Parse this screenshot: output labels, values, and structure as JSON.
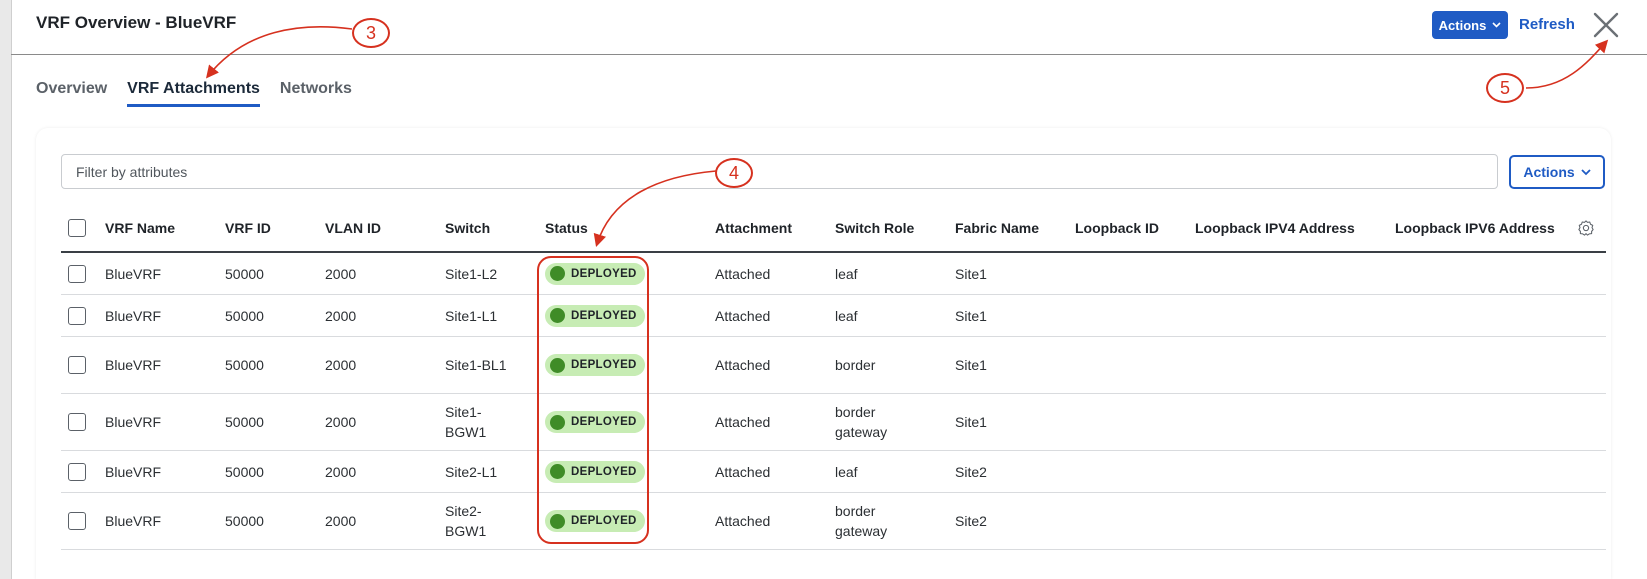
{
  "header": {
    "title": "VRF Overview - BlueVRF",
    "actions_label": "Actions",
    "refresh_label": "Refresh"
  },
  "tabs": [
    {
      "label": "Overview",
      "active": false
    },
    {
      "label": "VRF Attachments",
      "active": true
    },
    {
      "label": "Networks",
      "active": false
    }
  ],
  "toolbar": {
    "filter_placeholder": "Filter by attributes",
    "actions_label": "Actions"
  },
  "table": {
    "columns": [
      "VRF Name",
      "VRF ID",
      "VLAN ID",
      "Switch",
      "Status",
      "Attachment",
      "Switch Role",
      "Fabric Name",
      "Loopback ID",
      "Loopback IPV4 Address",
      "Loopback IPV6 Address"
    ],
    "rows": [
      {
        "vrf_name": "BlueVRF",
        "vrf_id": "50000",
        "vlan_id": "2000",
        "switch": "Site1-L2",
        "status": "DEPLOYED",
        "attachment": "Attached",
        "switch_role": "leaf",
        "fabric_name": "Site1",
        "loopback_id": "",
        "loopback_ipv4": "",
        "loopback_ipv6": ""
      },
      {
        "vrf_name": "BlueVRF",
        "vrf_id": "50000",
        "vlan_id": "2000",
        "switch": "Site1-L1",
        "status": "DEPLOYED",
        "attachment": "Attached",
        "switch_role": "leaf",
        "fabric_name": "Site1",
        "loopback_id": "",
        "loopback_ipv4": "",
        "loopback_ipv6": ""
      },
      {
        "vrf_name": "BlueVRF",
        "vrf_id": "50000",
        "vlan_id": "2000",
        "switch": "Site1-BL1",
        "status": "DEPLOYED",
        "attachment": "Attached",
        "switch_role": "border",
        "fabric_name": "Site1",
        "loopback_id": "",
        "loopback_ipv4": "",
        "loopback_ipv6": ""
      },
      {
        "vrf_name": "BlueVRF",
        "vrf_id": "50000",
        "vlan_id": "2000",
        "switch": "Site1-BGW1",
        "status": "DEPLOYED",
        "attachment": "Attached",
        "switch_role": "border gateway",
        "fabric_name": "Site1",
        "loopback_id": "",
        "loopback_ipv4": "",
        "loopback_ipv6": ""
      },
      {
        "vrf_name": "BlueVRF",
        "vrf_id": "50000",
        "vlan_id": "2000",
        "switch": "Site2-L1",
        "status": "DEPLOYED",
        "attachment": "Attached",
        "switch_role": "leaf",
        "fabric_name": "Site2",
        "loopback_id": "",
        "loopback_ipv4": "",
        "loopback_ipv6": ""
      },
      {
        "vrf_name": "BlueVRF",
        "vrf_id": "50000",
        "vlan_id": "2000",
        "switch": "Site2-BGW1",
        "status": "DEPLOYED",
        "attachment": "Attached",
        "switch_role": "border gateway",
        "fabric_name": "Site2",
        "loopback_id": "",
        "loopback_ipv4": "",
        "loopback_ipv6": ""
      }
    ]
  },
  "annotations": {
    "callout_3": "3",
    "callout_4": "4",
    "callout_5": "5"
  },
  "colors": {
    "accent": "#1f5bc4",
    "deployed_badge": "#c7ecb4",
    "deployed_dot": "#3f8c27",
    "annotation": "#d6311f"
  },
  "icons": [
    "chevron-down-icon",
    "close-icon",
    "settings-gear-icon",
    "status-dot-icon"
  ]
}
